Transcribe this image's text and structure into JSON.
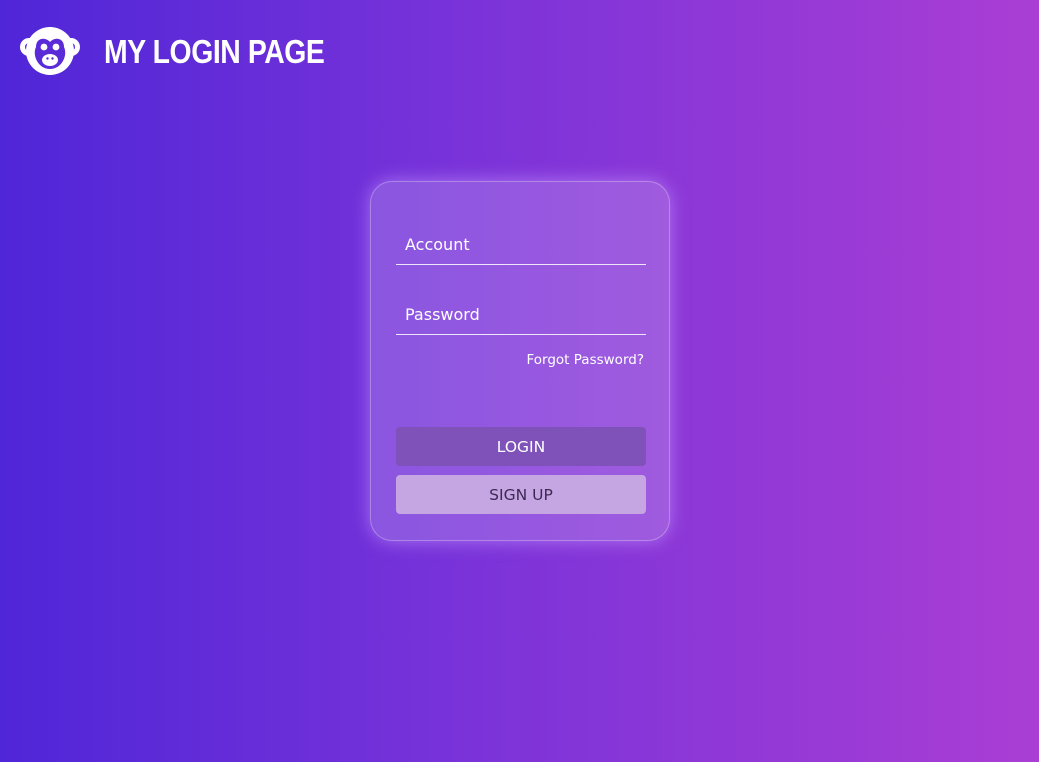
{
  "header": {
    "logo_icon": "monkey-icon",
    "title": "MY LOGIN PAGE"
  },
  "login_form": {
    "account": {
      "value": "",
      "placeholder": "Account"
    },
    "password": {
      "value": "",
      "placeholder": "Password"
    },
    "forgot_password_label": "Forgot Password?",
    "login_label": "LOGIN",
    "signup_label": "SIGN UP"
  },
  "colors": {
    "background_start": "#4f26d8",
    "background_end": "#aa3ed4",
    "login_button": "#7e52b8",
    "signup_button": "#c6a5e3"
  }
}
